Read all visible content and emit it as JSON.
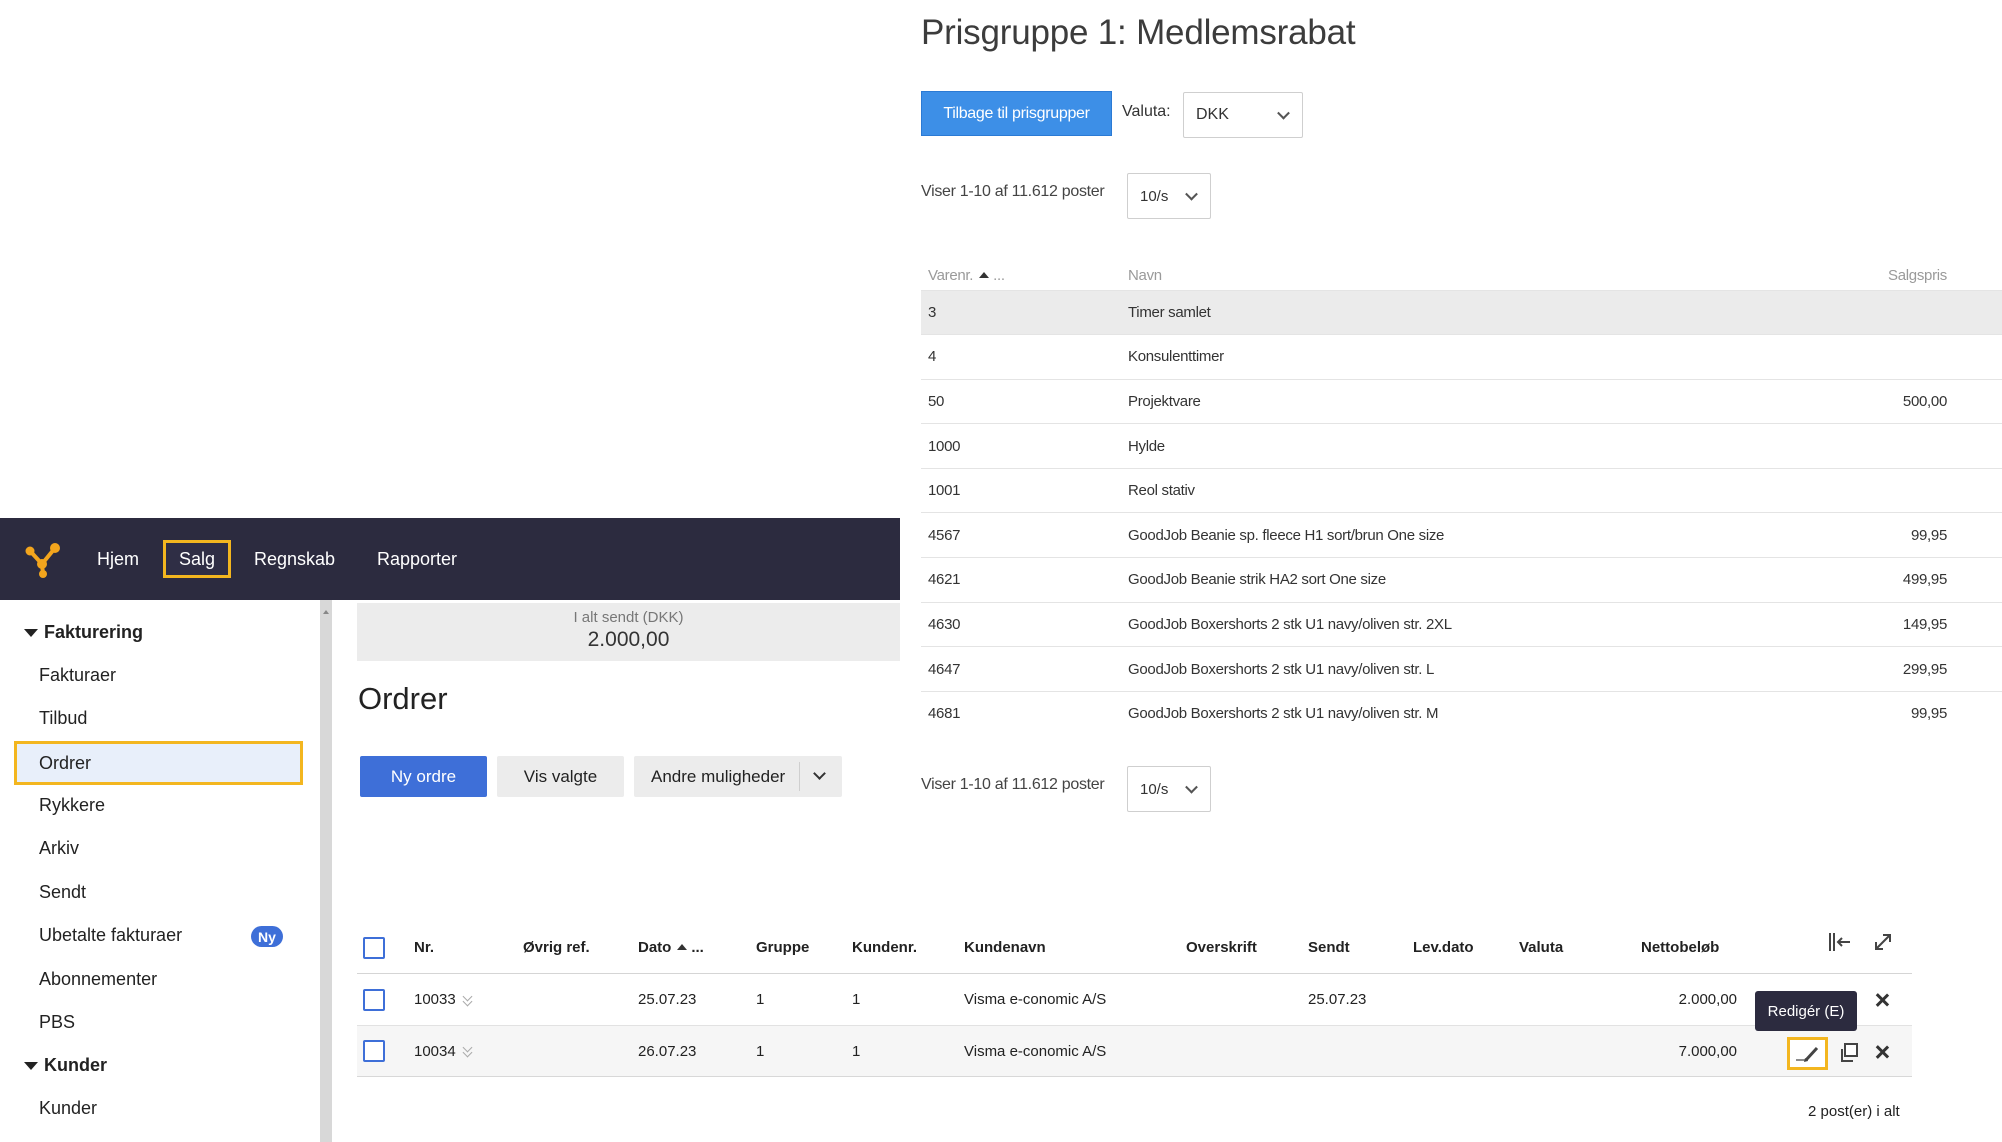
{
  "prisgruppe": {
    "title": "Prisgruppe 1: Medlemsrabat",
    "back_button": "Tilbage til prisgrupper",
    "valuta_label": "Valuta:",
    "valuta_value": "DKK",
    "pager_text": "Viser 1-10 af 11.612 poster",
    "per_page": "10/s",
    "columns": {
      "varenr": "Varenr.",
      "varenr_more": "...",
      "navn": "Navn",
      "salgspris": "Salgspris"
    },
    "rows": [
      {
        "varenr": "3",
        "navn": "Timer samlet",
        "salgspris": ""
      },
      {
        "varenr": "4",
        "navn": "Konsulenttimer",
        "salgspris": ""
      },
      {
        "varenr": "50",
        "navn": "Projektvare",
        "salgspris": "500,00"
      },
      {
        "varenr": "1000",
        "navn": "Hylde",
        "salgspris": ""
      },
      {
        "varenr": "1001",
        "navn": "Reol stativ",
        "salgspris": ""
      },
      {
        "varenr": "4567",
        "navn": "GoodJob Beanie sp. fleece H1 sort/brun One size",
        "salgspris": "99,95"
      },
      {
        "varenr": "4621",
        "navn": "GoodJob Beanie strik HA2 sort One size",
        "salgspris": "499,95"
      },
      {
        "varenr": "4630",
        "navn": "GoodJob Boxershorts 2 stk U1 navy/oliven str. 2XL",
        "salgspris": "149,95"
      },
      {
        "varenr": "4647",
        "navn": "GoodJob Boxershorts 2 stk U1 navy/oliven str. L",
        "salgspris": "299,95"
      },
      {
        "varenr": "4681",
        "navn": "GoodJob Boxershorts 2 stk U1 navy/oliven str. M",
        "salgspris": "99,95"
      }
    ]
  },
  "app": {
    "nav": {
      "hjem": "Hjem",
      "salg": "Salg",
      "regnskab": "Regnskab",
      "rapporter": "Rapporter"
    },
    "sidebar": {
      "section_fakturering": "Fakturering",
      "fakturaer": "Fakturaer",
      "tilbud": "Tilbud",
      "ordrer": "Ordrer",
      "rykkere": "Rykkere",
      "arkiv": "Arkiv",
      "sendt": "Sendt",
      "ubetalte": "Ubetalte fakturaer",
      "ubetalte_badge": "Ny",
      "abonnementer": "Abonnementer",
      "pbs": "PBS",
      "section_kunder": "Kunder",
      "kunder": "Kunder"
    },
    "summary": {
      "label": "I alt sendt (DKK)",
      "value": "2.000,00"
    },
    "page_title": "Ordrer",
    "buttons": {
      "ny_ordre": "Ny ordre",
      "vis_valgte": "Vis valgte",
      "andre": "Andre muligheder"
    }
  },
  "orders": {
    "columns": {
      "nr": "Nr.",
      "ref": "Øvrig ref.",
      "dato": "Dato",
      "dato_more": "...",
      "gruppe": "Gruppe",
      "kundenr": "Kundenr.",
      "kundenavn": "Kundenavn",
      "overskrift": "Overskrift",
      "sendt": "Sendt",
      "levdato": "Lev.dato",
      "valuta": "Valuta",
      "netto": "Nettobeløb"
    },
    "rows": [
      {
        "nr": "10033",
        "dato": "25.07.23",
        "gruppe": "1",
        "kundenr": "1",
        "kundenavn": "Visma e-conomic A/S",
        "sendt": "25.07.23",
        "netto": "2.000,00"
      },
      {
        "nr": "10034",
        "dato": "26.07.23",
        "gruppe": "1",
        "kundenr": "1",
        "kundenavn": "Visma e-conomic A/S",
        "sendt": "",
        "netto": "7.000,00"
      }
    ],
    "tooltip": "Redigér (E)",
    "total": "2 post(er) i alt"
  },
  "colors": {
    "nav_bg": "#2c2b3f",
    "highlight": "#f3b61f",
    "primary": "#3e6fd8",
    "pg_button": "#3d8fe7",
    "logo": "#f3a51d"
  }
}
